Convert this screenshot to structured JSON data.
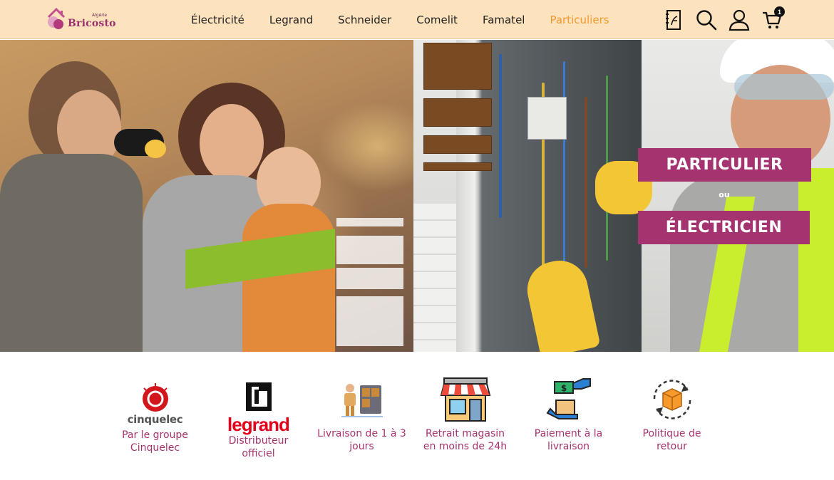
{
  "header": {
    "logo": {
      "country": "Algérie",
      "name": "Bricosto"
    },
    "nav": [
      {
        "label": "Électricité",
        "active": false
      },
      {
        "label": "Legrand",
        "active": false
      },
      {
        "label": "Schneider",
        "active": false
      },
      {
        "label": "Comelit",
        "active": false
      },
      {
        "label": "Famatel",
        "active": false
      },
      {
        "label": "Particuliers",
        "active": true
      }
    ],
    "icons": [
      "catalog-icon",
      "search-icon",
      "user-icon",
      "cart-icon"
    ],
    "cart_count": "1"
  },
  "hero": {
    "cta_particulier": "PARTICULIER",
    "or_text": "ou",
    "cta_electricien": "ÉLECTRICIEN"
  },
  "features": [
    {
      "icon": "cinquelec-logo",
      "brand": "cinquelec",
      "label": "Par le groupe\nCinquelec"
    },
    {
      "icon": "legrand-logo",
      "brand": "legrand",
      "label": "Distributeur\nofficiel"
    },
    {
      "icon": "delivery-icon",
      "label": "Livraison de 1 à 3\njours"
    },
    {
      "icon": "store-icon",
      "label": "Retrait magasin\nen moins de 24h"
    },
    {
      "icon": "cash-on-delivery-icon",
      "label": "Paiement à la\nlivraison"
    },
    {
      "icon": "return-box-icon",
      "label": "Politique de\nretour"
    }
  ],
  "colors": {
    "header_bg": "#fde3bd",
    "nav_active": "#f29a32",
    "accent": "#a5336f",
    "legrand_red": "#e2001a"
  }
}
